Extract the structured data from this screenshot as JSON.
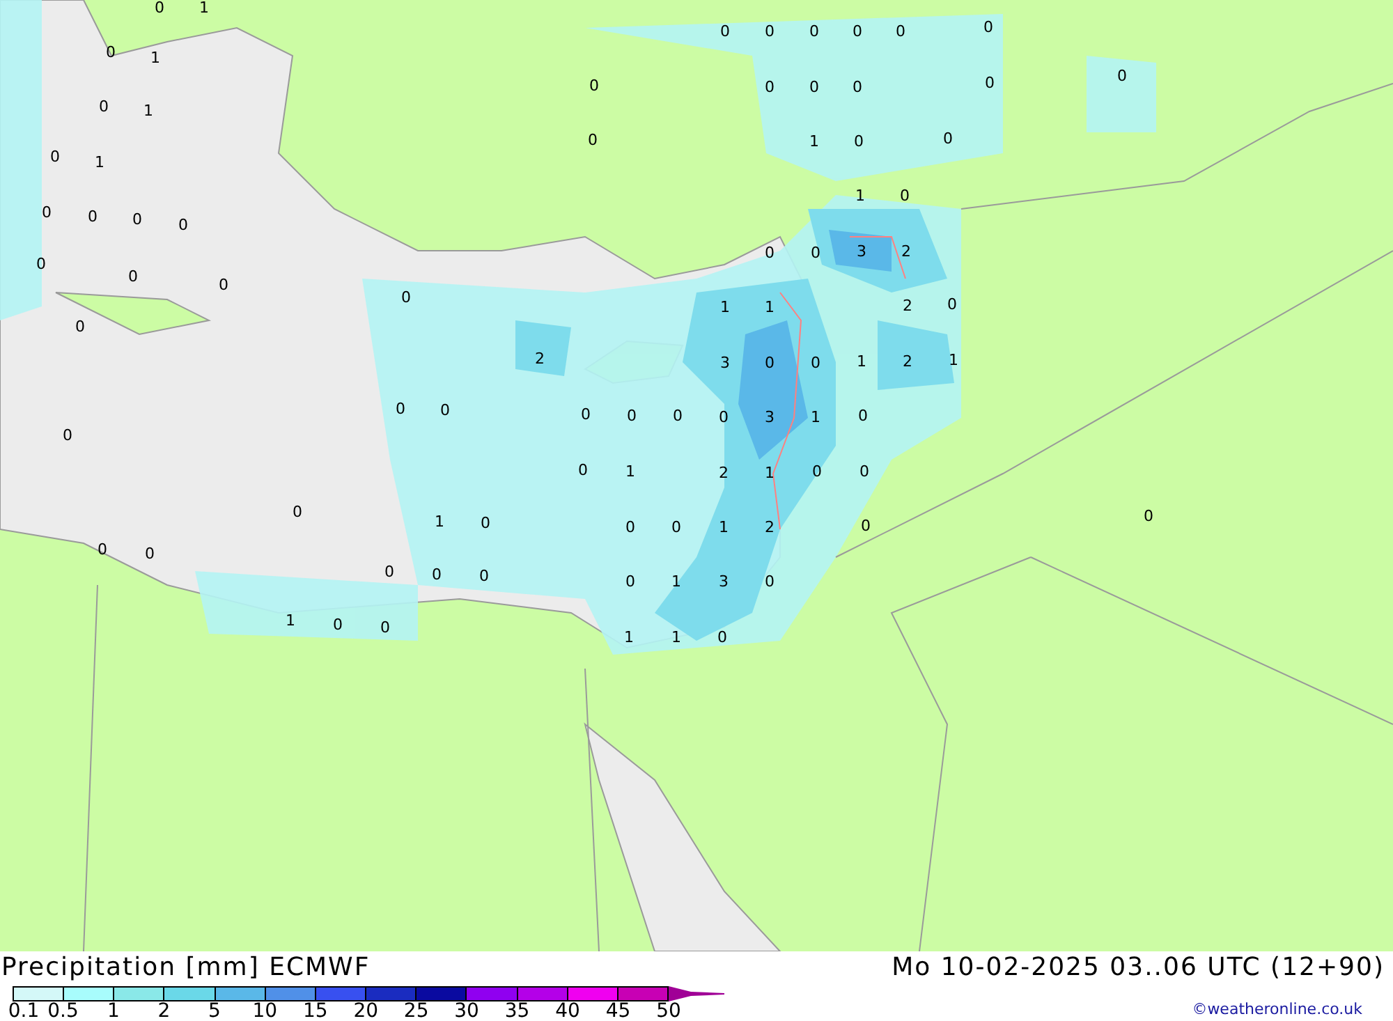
{
  "map": {
    "values": [
      "0",
      "1",
      "0",
      "0",
      "0",
      "0",
      "0",
      "0",
      "0",
      "1",
      "0",
      "0",
      "0",
      "0",
      "0",
      "0",
      "0",
      "1",
      "0",
      "1",
      "0",
      "0",
      "0",
      "1",
      "1",
      "0",
      "0",
      "0",
      "0",
      "0",
      "0",
      "0",
      "3",
      "2",
      "0",
      "0",
      "0",
      "0",
      "1",
      "1",
      "2",
      "0",
      "0",
      "2",
      "3",
      "0",
      "0",
      "1",
      "2",
      "1",
      "0",
      "0",
      "0",
      "0",
      "0",
      "0",
      "3",
      "1",
      "0",
      "0",
      "0",
      "1",
      "2",
      "1",
      "0",
      "0",
      "0",
      "0",
      "1",
      "0",
      "0",
      "0",
      "1",
      "2",
      "0",
      "0",
      "0",
      "0",
      "0",
      "0",
      "0",
      "1",
      "3",
      "0",
      "1",
      "0",
      "0",
      "1",
      "1",
      "0"
    ]
  },
  "footer": {
    "title": "Precipitation [mm] ECMWF",
    "datetime": "Mo 10-02-2025 03..06 UTC (12+90)",
    "credit": "©weatheronline.co.uk",
    "legend": {
      "bins": [
        {
          "color": "#d4f8f8"
        },
        {
          "color": "#a8fcfc"
        },
        {
          "color": "#8ae8e8"
        },
        {
          "color": "#6ad8e8"
        },
        {
          "color": "#5ab8e8"
        },
        {
          "color": "#5090e8"
        },
        {
          "color": "#3850f0"
        },
        {
          "color": "#1a2cc0"
        },
        {
          "color": "#0a0aa0"
        },
        {
          "color": "#9000f0"
        },
        {
          "color": "#b400e8"
        },
        {
          "color": "#f000f0"
        },
        {
          "color": "#c800b4"
        }
      ],
      "arrow": {
        "color": "#a00096"
      },
      "labels": [
        "0.1",
        "0.5",
        "1",
        "2",
        "5",
        "10",
        "15",
        "20",
        "25",
        "30",
        "35",
        "40",
        "45",
        "50"
      ]
    }
  }
}
